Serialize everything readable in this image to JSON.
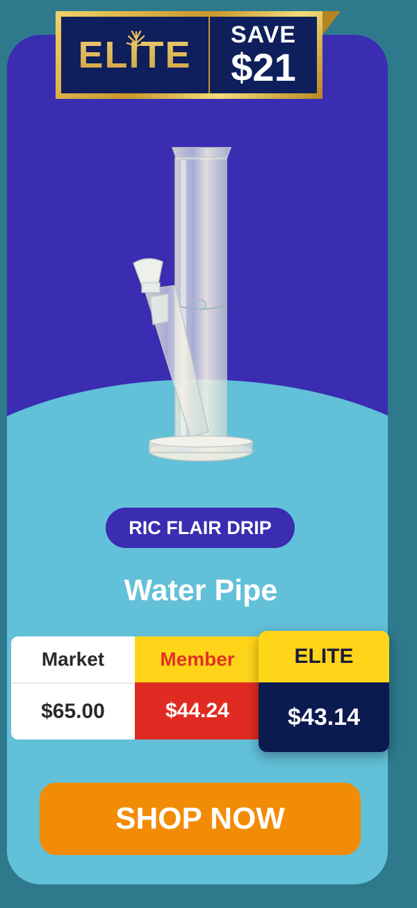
{
  "badge": {
    "logo_text": "ELITE",
    "save_label": "SAVE",
    "save_amount": "$21",
    "icon": "leaf-icon"
  },
  "product": {
    "brand": "RIC FLAIR DRIP",
    "name": "Water Pipe",
    "image_icon": "water-pipe-image"
  },
  "pricing": {
    "market_label": "Market",
    "market_price": "$65.00",
    "member_label": "Member",
    "member_price": "$44.24",
    "elite_label": "ELITE",
    "elite_price": "$43.14"
  },
  "cta": {
    "label": "SHOP NOW"
  },
  "colors": {
    "background": "#2e7a8c",
    "card_top": "#3a2db2",
    "card_bottom": "#62c0d9",
    "gold": "#c9972b",
    "navy": "#0f1f5c",
    "yellow": "#ffd51a",
    "red": "#e02b22",
    "orange": "#f28c07"
  }
}
